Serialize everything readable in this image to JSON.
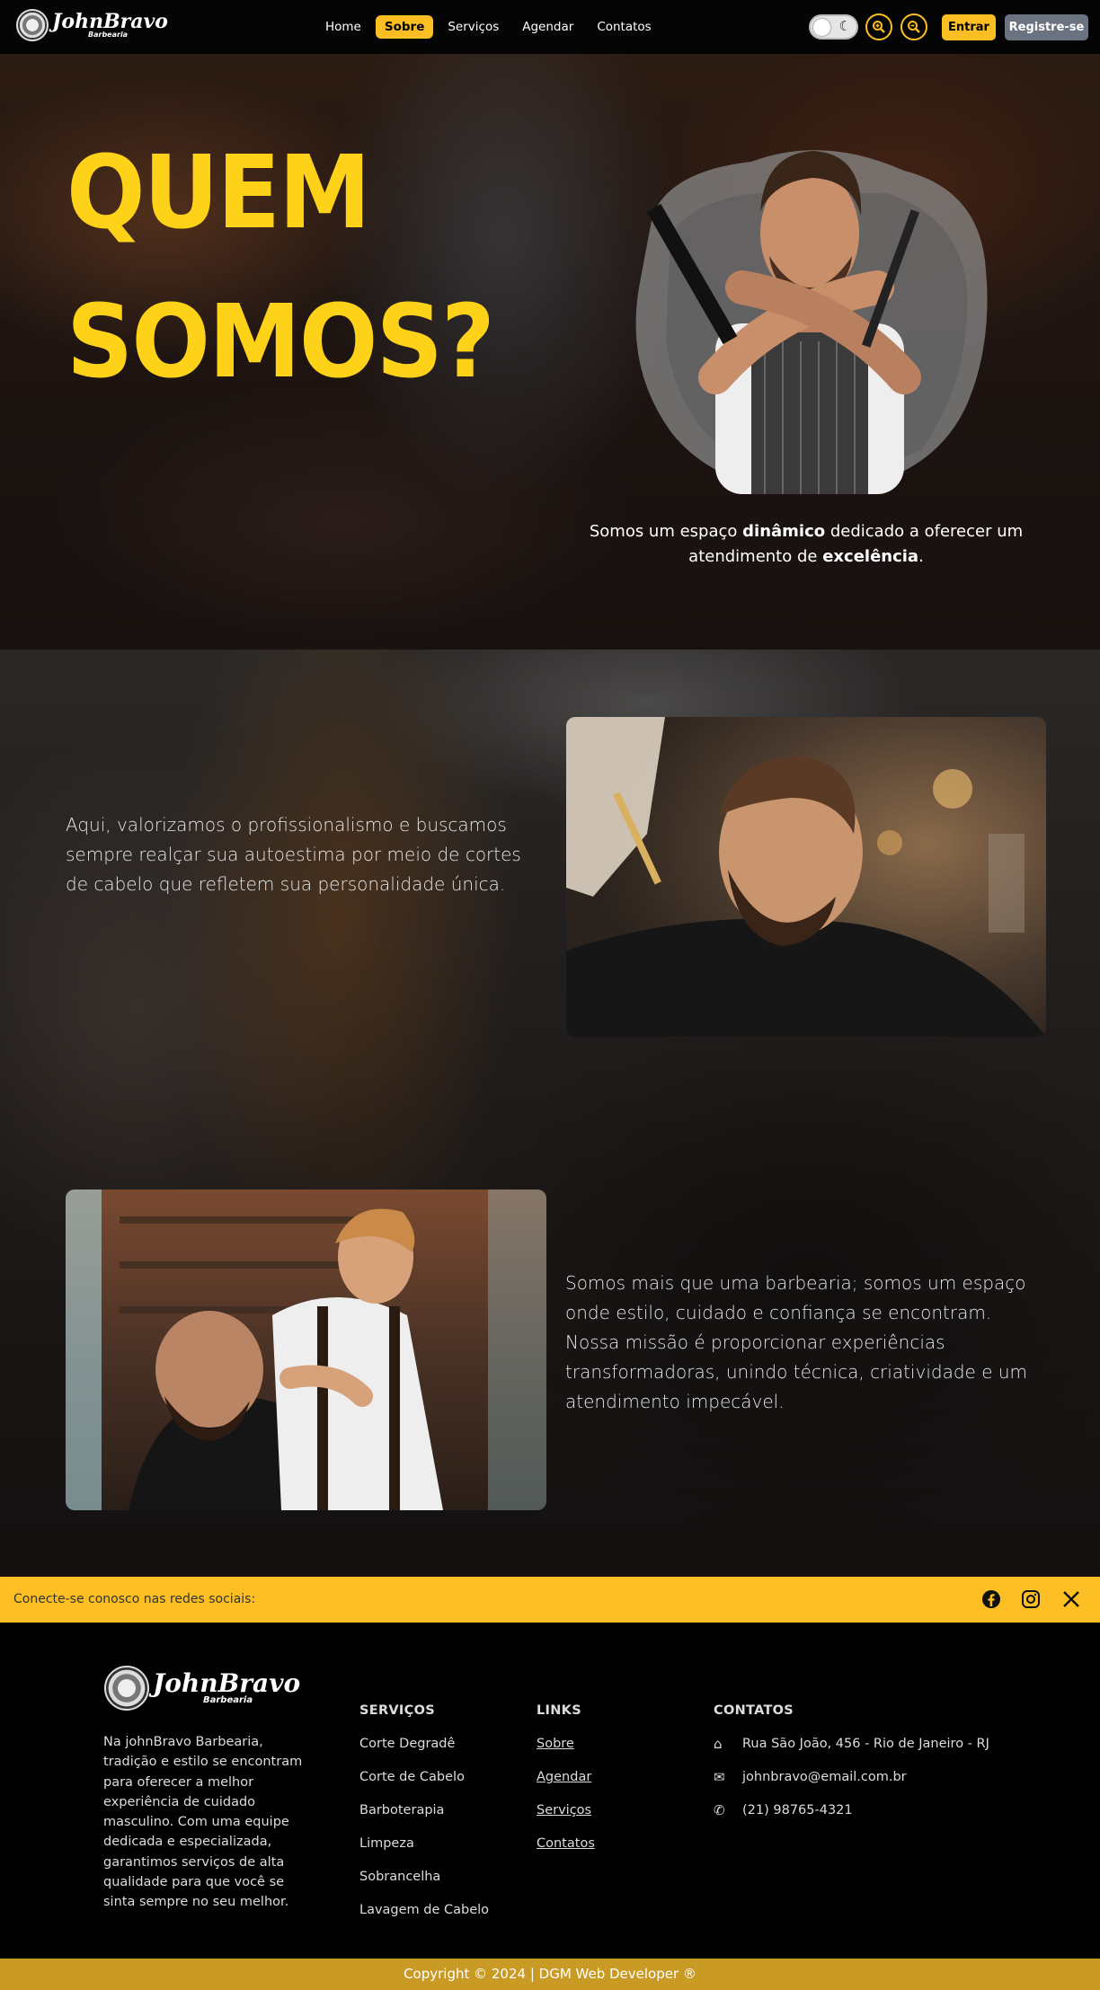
{
  "nav": {
    "brand_name": "JohnBravo",
    "brand_sub": "Barbearia",
    "items": [
      {
        "label": "Home",
        "active": false
      },
      {
        "label": "Sobre",
        "active": true
      },
      {
        "label": "Serviços",
        "active": false
      },
      {
        "label": "Agendar",
        "active": false
      },
      {
        "label": "Contatos",
        "active": false
      }
    ],
    "theme_icon": "moon-icon",
    "zoom_in_icon": "zoom-in-icon",
    "zoom_out_icon": "zoom-out-icon",
    "login_label": "Entrar",
    "register_label": "Registre-se"
  },
  "hero": {
    "title_line1": "QUEM",
    "title_line2": "SOMOS?",
    "text_a": "Somos um espaço ",
    "text_b": "dinâmico",
    "text_c": " dedicado a oferecer um atendimento de ",
    "text_d": "excelência",
    "text_e": "."
  },
  "about": {
    "paragraph1": "Aqui, valorizamos o profissionalismo e buscamos sempre realçar sua autoestima por meio de cortes de cabelo que refletem sua personalidade única.",
    "paragraph2": "Somos mais que uma barbearia; somos um espaço onde estilo, cuidado e confiança se encontram. Nossa missão é proporcionar experiências transformadoras, unindo técnica, criatividade e um atendimento impecável."
  },
  "social": {
    "text": "Conecte-se conosco nas redes sociais:",
    "icons": [
      "facebook-icon",
      "instagram-icon",
      "x-icon"
    ]
  },
  "footer": {
    "brand_name": "JohnBravo",
    "brand_sub": "Barbearia",
    "about": "Na johnBravo Barbearia, tradição e estilo se encontram para oferecer a melhor experiência de cuidado masculino. Com uma equipe dedicada e especializada, garantimos serviços de alta qualidade para que você se sinta sempre no seu melhor.",
    "services_title": "SERVIÇOS",
    "services": [
      "Corte Degradê",
      "Corte de Cabelo",
      "Barboterapia",
      "Limpeza",
      "Sobrancelha",
      "Lavagem de Cabelo"
    ],
    "links_title": "LINKS",
    "links": [
      "Sobre",
      "Agendar",
      "Serviços",
      "Contatos"
    ],
    "contacts_title": "CONTATOS",
    "contacts": [
      {
        "icon": "home-icon",
        "text": "Rua São João, 456 - Rio de Janeiro - RJ"
      },
      {
        "icon": "mail-icon",
        "text": "johnbravo@email.com.br"
      },
      {
        "icon": "phone-icon",
        "text": "(21) 98765-4321"
      }
    ],
    "copyright": "Copyright © 2024 | DGM Web Developer ®"
  },
  "colors": {
    "accent": "#fbbf24",
    "title": "#ffd21a",
    "copyright_bar": "#c99a24"
  }
}
